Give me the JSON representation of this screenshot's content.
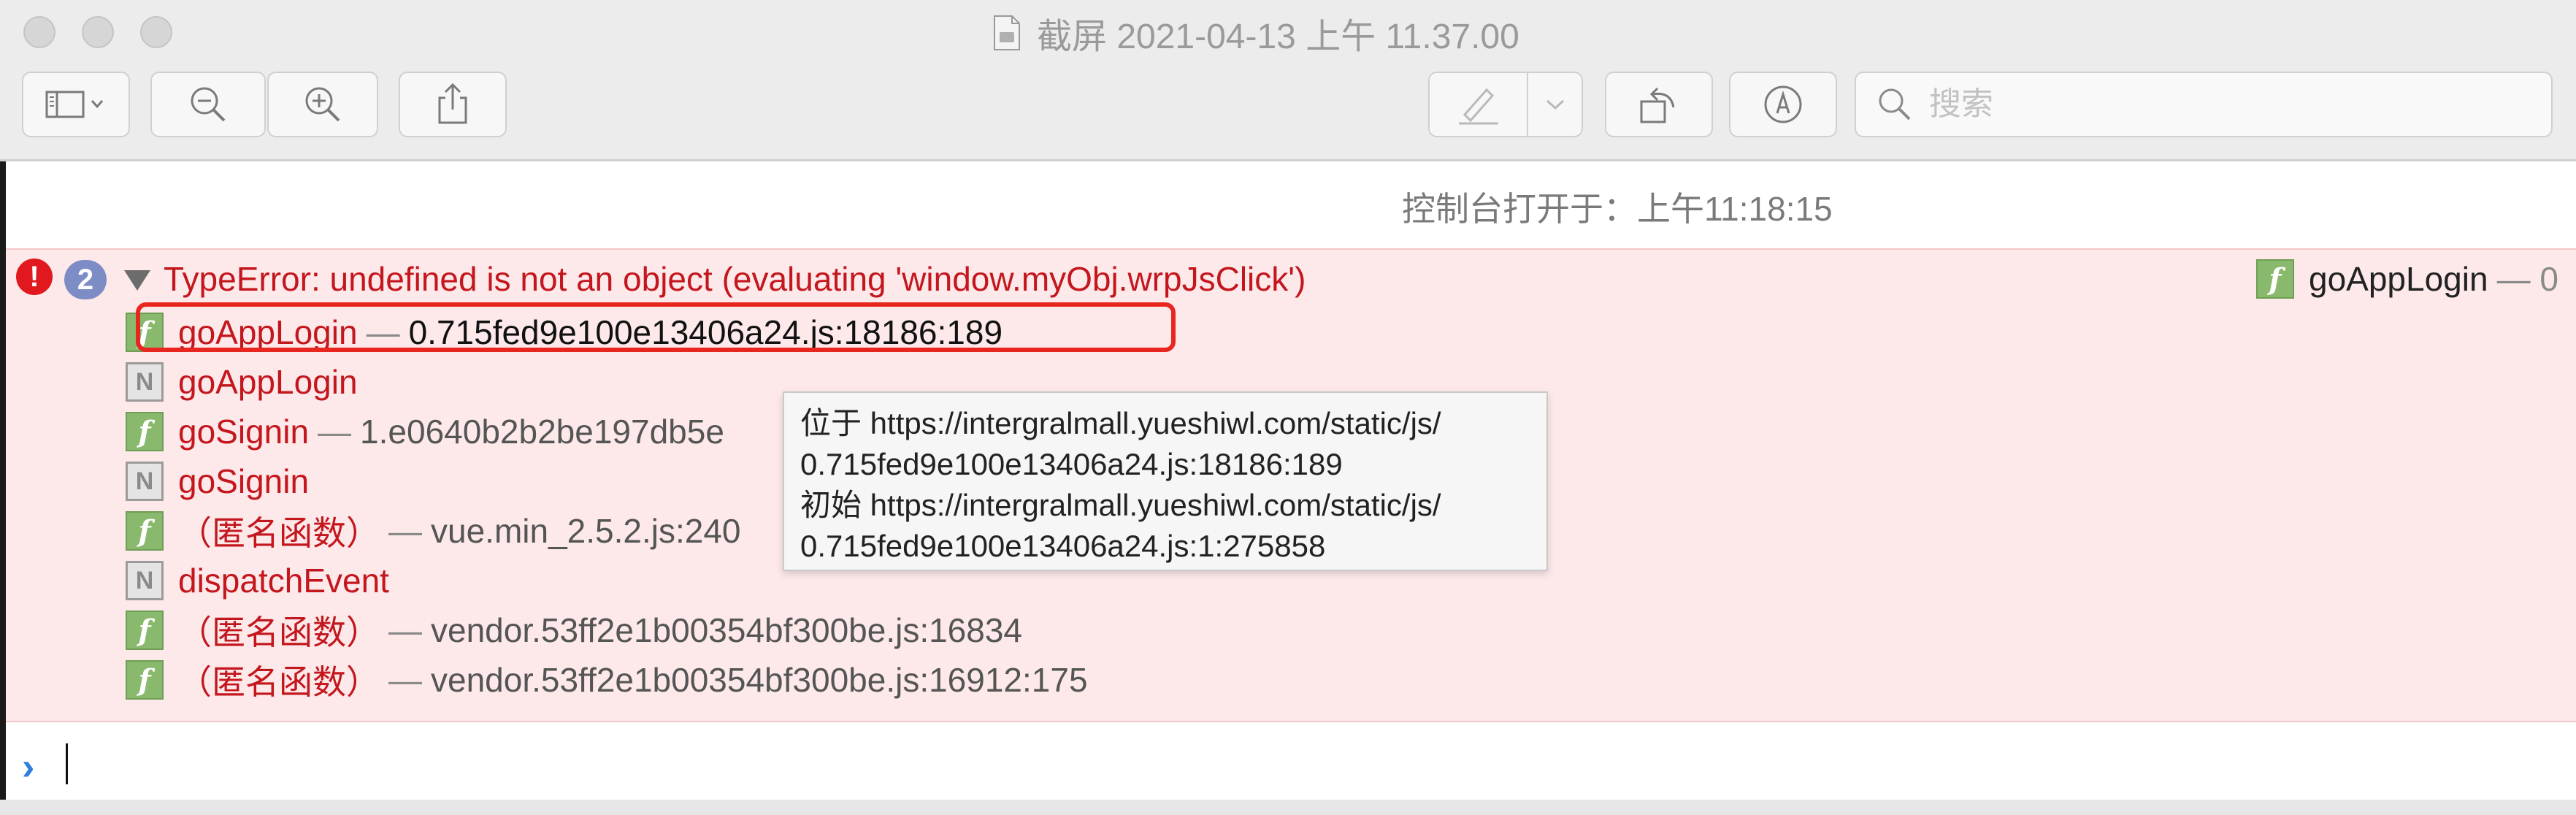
{
  "window": {
    "title": "截屏 2021-04-13 上午 11.37.00",
    "search_placeholder": "搜索"
  },
  "console": {
    "opened_at": "控制台打开于：上午11:18:15",
    "error": {
      "count": "2",
      "message": "TypeError: undefined is not an object (evaluating 'window.myObj.wrpJsClick')",
      "right_frame": "goAppLogin",
      "right_dash": "— 0"
    },
    "frames": [
      {
        "type": "f",
        "name": "goAppLogin",
        "location": "0.715fed9e100e13406a24.js:18186:189"
      },
      {
        "type": "N",
        "name": "goAppLogin",
        "location": ""
      },
      {
        "type": "f",
        "name": "goSignin",
        "location": "1.e0640b2b2be197db5e"
      },
      {
        "type": "N",
        "name": "goSignin",
        "location": ""
      },
      {
        "type": "f",
        "name": "（匿名函数）",
        "location": "vue.min_2.5.2.js:240"
      },
      {
        "type": "N",
        "name": "dispatchEvent",
        "location": ""
      },
      {
        "type": "f",
        "name": "（匿名函数）",
        "location": "vendor.53ff2e1b00354bf300be.js:16834"
      },
      {
        "type": "f",
        "name": "（匿名函数）",
        "location": "vendor.53ff2e1b00354bf300be.js:16912:175"
      }
    ],
    "tooltip": {
      "line1": "位于 https://intergralmall.yueshiwl.com/static/js/",
      "line2": "0.715fed9e100e13406a24.js:18186:189",
      "line3": "初始 https://intergralmall.yueshiwl.com/static/js/",
      "line4": "0.715fed9e100e13406a24.js:1:275858"
    },
    "badge_f": "f",
    "badge_n": "N",
    "dash": "—",
    "prompt": "›"
  },
  "colors": {
    "error_red": "#c4161d",
    "error_bg": "#fde9ea",
    "highlight": "#e8251f",
    "func_badge": "#88b96d"
  }
}
